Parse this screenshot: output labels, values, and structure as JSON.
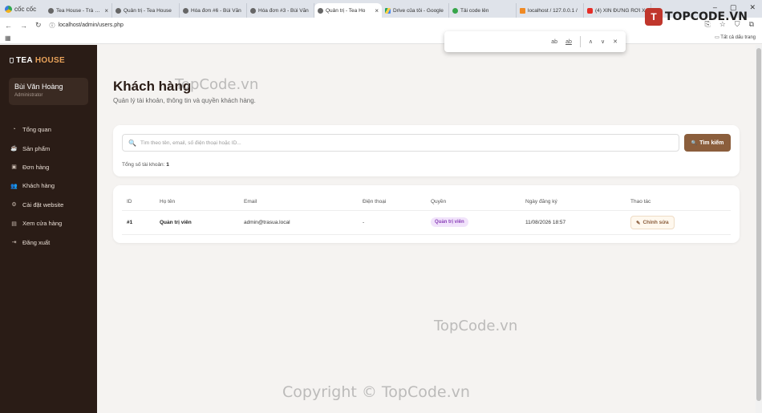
{
  "browser": {
    "brand": "cốc cốc",
    "tabs": [
      {
        "label": "Tea House - Trà sữa ng",
        "icon": "globe-icon"
      },
      {
        "label": "Quản trị - Tea House",
        "icon": "globe-icon"
      },
      {
        "label": "Hóa đơn #6 - Bùi Văn",
        "icon": "globe-icon"
      },
      {
        "label": "Hóa đơn #3 - Bùi Văn",
        "icon": "globe-icon"
      },
      {
        "label": "Quản trị - Tea Ho",
        "icon": "globe-icon",
        "active": true
      },
      {
        "label": "Drive của tôi - Google",
        "icon": "drive-icon"
      },
      {
        "label": "Tải code lên",
        "icon": "upload-icon"
      },
      {
        "label": "localhost / 127.0.0.1 /",
        "icon": "phpmyadmin-icon"
      },
      {
        "label": "(4) XIN ĐỪNG RỜI X",
        "icon": "youtube-icon"
      }
    ],
    "url": "localhost/admin/users.php",
    "bookmarks_all": "Tất cả dấu trang",
    "find": {
      "match_case": "ab",
      "whole_word": "ab"
    }
  },
  "overlay_logo": "TOPCODE.VN",
  "watermarks": {
    "top": "TopCode.vn",
    "middle": "TopCode.vn",
    "bottom": "Copyright © TopCode.vn"
  },
  "sidebar": {
    "brand_main": "TEA",
    "brand_accent": "HOUSE",
    "user": {
      "name": "Bùi Văn Hoàng",
      "role": "Administrator"
    },
    "items": [
      {
        "label": "Tổng quan",
        "icon": "dashboard-icon"
      },
      {
        "label": "Sản phẩm",
        "icon": "cup-icon"
      },
      {
        "label": "Đơn hàng",
        "icon": "box-icon"
      },
      {
        "label": "Khách hàng",
        "icon": "users-icon"
      },
      {
        "label": "Cài đặt website",
        "icon": "gear-icon"
      },
      {
        "label": "Xem cửa hàng",
        "icon": "store-icon"
      },
      {
        "label": "Đăng xuất",
        "icon": "logout-icon"
      }
    ]
  },
  "main": {
    "title": "Khách hàng",
    "subtitle": "Quản lý tài khoản, thông tin và quyền khách hàng.",
    "search": {
      "placeholder": "Tìm theo tên, email, số điện thoại hoặc ID...",
      "value": "",
      "button_label": "Tìm kiếm"
    },
    "count_label": "Tổng số tài khoản:",
    "count_value": "1",
    "table": {
      "columns": [
        "ID",
        "Họ tên",
        "Email",
        "Điện thoại",
        "Quyền",
        "Ngày đăng ký",
        "Thao tác"
      ],
      "rows": [
        {
          "id": "#1",
          "name": "Quản trị viên",
          "email": "admin@trasua.local",
          "phone": "-",
          "role": "Quản trị viên",
          "date": "11/08/2026 18:57",
          "action": "Chỉnh sửa"
        }
      ]
    }
  },
  "colors": {
    "sidebar_bg": "#2a1c16",
    "accent": "#8b5e3c",
    "role_badge": "#8a3fb8"
  }
}
